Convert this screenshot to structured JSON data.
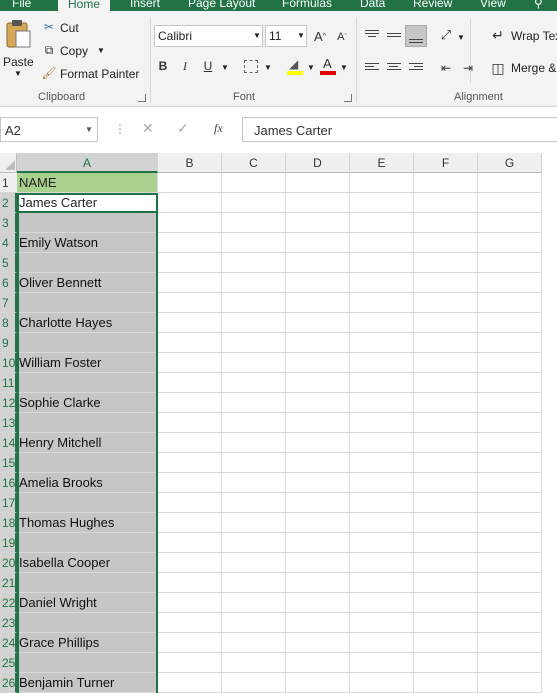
{
  "tabs": [
    "File",
    "Home",
    "Insert",
    "Page Layout",
    "Formulas",
    "Data",
    "Review",
    "View"
  ],
  "tab_active": "Home",
  "clipboard": {
    "paste": "Paste",
    "cut": "Cut",
    "copy": "Copy",
    "format_painter": "Format Painter",
    "label": "Clipboard"
  },
  "font": {
    "name": "Calibri",
    "size": "11",
    "bold": "B",
    "italic": "I",
    "underline": "U",
    "label": "Font"
  },
  "alignment": {
    "wrap_text": "Wrap Text",
    "merge": "Merge &",
    "label": "Alignment"
  },
  "formula_bar": {
    "name_box": "A2",
    "fx": "fx",
    "value": "James Carter"
  },
  "columns": [
    "A",
    "B",
    "C",
    "D",
    "E",
    "F",
    "G"
  ],
  "rows": [
    {
      "num": "1",
      "a": "NAME"
    },
    {
      "num": "2",
      "a": "James Carter"
    },
    {
      "num": "3",
      "a": ""
    },
    {
      "num": "4",
      "a": "Emily Watson"
    },
    {
      "num": "5",
      "a": ""
    },
    {
      "num": "6",
      "a": "Oliver Bennett"
    },
    {
      "num": "7",
      "a": ""
    },
    {
      "num": "8",
      "a": "Charlotte Hayes"
    },
    {
      "num": "9",
      "a": ""
    },
    {
      "num": "10",
      "a": "William Foster"
    },
    {
      "num": "11",
      "a": ""
    },
    {
      "num": "12",
      "a": "Sophie Clarke"
    },
    {
      "num": "13",
      "a": ""
    },
    {
      "num": "14",
      "a": "Henry Mitchell"
    },
    {
      "num": "15",
      "a": ""
    },
    {
      "num": "16",
      "a": "Amelia Brooks"
    },
    {
      "num": "17",
      "a": ""
    },
    {
      "num": "18",
      "a": "Thomas Hughes"
    },
    {
      "num": "19",
      "a": ""
    },
    {
      "num": "20",
      "a": "Isabella Cooper"
    },
    {
      "num": "21",
      "a": ""
    },
    {
      "num": "22",
      "a": "Daniel Wright"
    },
    {
      "num": "23",
      "a": ""
    },
    {
      "num": "24",
      "a": "Grace Phillips"
    },
    {
      "num": "25",
      "a": ""
    },
    {
      "num": "26",
      "a": "Benjamin Turner"
    }
  ],
  "colors": {
    "accent": "#217346",
    "header_fill": "#a9d08e",
    "selection_fill": "#c6c6c6"
  }
}
